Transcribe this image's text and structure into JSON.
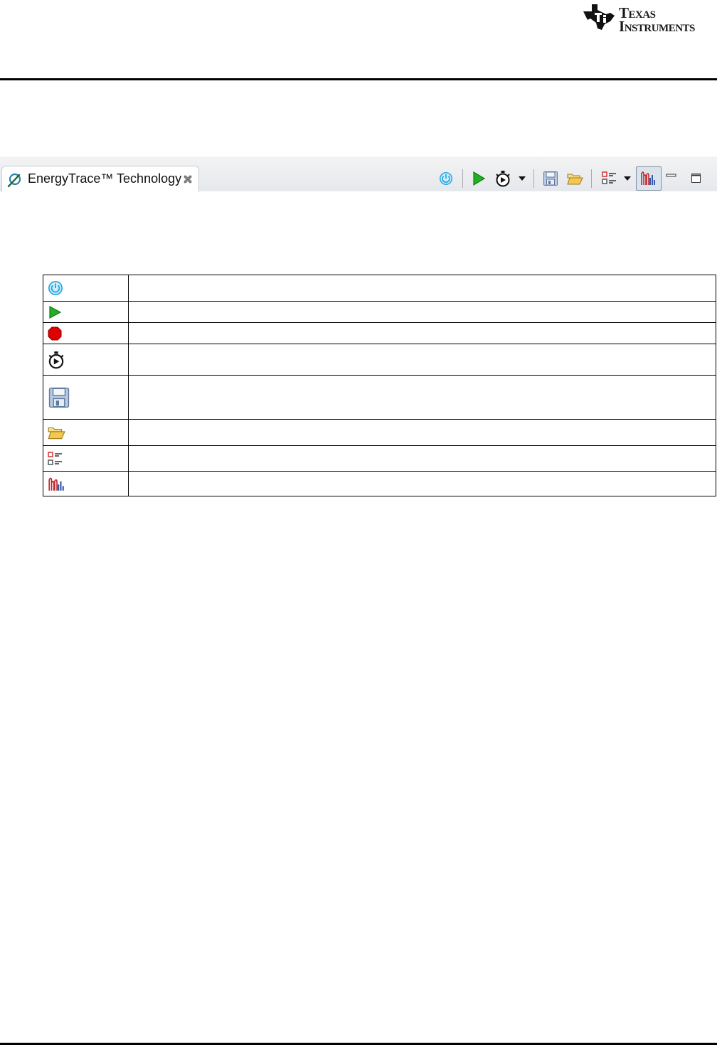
{
  "header": {
    "logo_line1_cap": "T",
    "logo_line1_rest": "EXAS",
    "logo_line2_cap": "I",
    "logo_line2_rest": "NSTRUMENTS"
  },
  "view": {
    "tab_icon": "energytrace-icon",
    "tab_label": "EnergyTrace™ Technology",
    "tab_close_icon": "close-icon",
    "toolbar": [
      {
        "icon": "power-icon"
      },
      {
        "icon": "start-icon"
      },
      {
        "icon": "stopwatch-icon"
      },
      {
        "icon": "dropdown-arrow-icon"
      },
      {
        "icon": "save-icon"
      },
      {
        "icon": "open-folder-icon"
      },
      {
        "icon": "preferences-icon"
      },
      {
        "icon": "dropdown-arrow-icon"
      },
      {
        "icon": "energytrace-plus-icon"
      },
      {
        "icon": "minimize-icon"
      },
      {
        "icon": "maximize-icon"
      }
    ]
  },
  "icon_table": {
    "rows": [
      {
        "icon": "power-icon",
        "description": ""
      },
      {
        "icon": "start-icon",
        "description": ""
      },
      {
        "icon": "stop-icon",
        "description": ""
      },
      {
        "icon": "stopwatch-icon",
        "description": ""
      },
      {
        "icon": "save-icon",
        "description": ""
      },
      {
        "icon": "open-folder-icon",
        "description": ""
      },
      {
        "icon": "preferences-icon",
        "description": ""
      },
      {
        "icon": "energytrace-plus-icon",
        "description": ""
      }
    ]
  },
  "colors": {
    "power": "#29a8e0",
    "start": "#22b022",
    "stop": "#e00000",
    "folder": "#f2c94c",
    "energytrace_plus": "#c0282d",
    "save": "#6f8fb8"
  }
}
